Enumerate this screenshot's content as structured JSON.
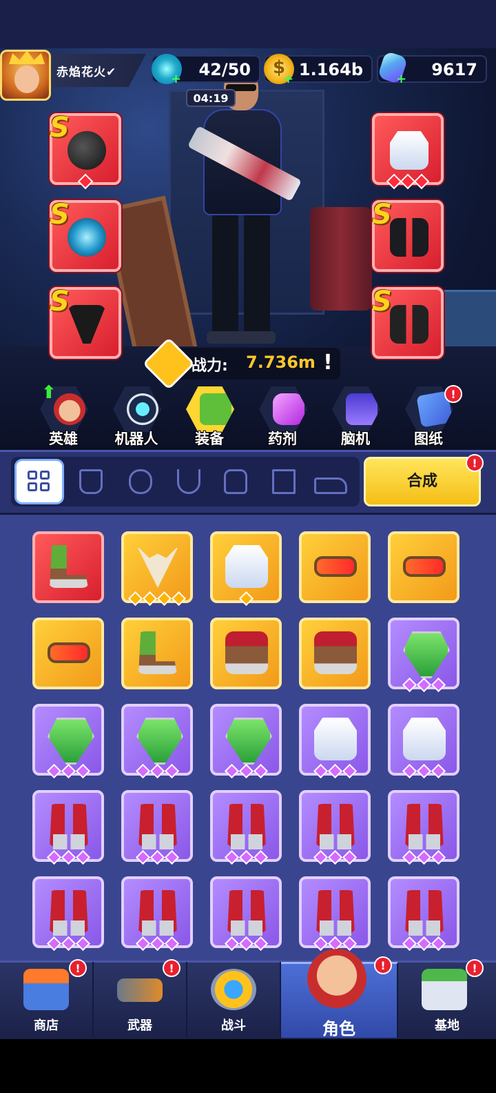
{
  "player": {
    "name": "赤焰花火✔"
  },
  "resources": {
    "energy": {
      "value": "42/50",
      "icon": "energy-icon"
    },
    "coins": {
      "value": "1.164b",
      "icon": "coin-icon"
    },
    "gems": {
      "value": "9617",
      "icon": "gem-icon"
    },
    "timer": "04:19"
  },
  "equipped": {
    "left": [
      {
        "grade": "S",
        "item": "bomb-icon",
        "stars": 1
      },
      {
        "grade": "S",
        "item": "shield-core-icon",
        "stars": 0
      },
      {
        "grade": "S",
        "item": "necklace-icon",
        "stars": 0
      }
    ],
    "right": [
      {
        "grade": "S",
        "item": "jacket-icon",
        "stars": 3
      },
      {
        "grade": "S",
        "item": "pants-icon",
        "stars": 0
      },
      {
        "grade": "S",
        "item": "boots-icon",
        "stars": 0
      }
    ]
  },
  "power": {
    "label": "战力:",
    "value": "7.736m",
    "info": "!"
  },
  "categories": [
    {
      "label": "英雄",
      "icon": "hero-icon"
    },
    {
      "label": "机器人",
      "icon": "robot-icon"
    },
    {
      "label": "装备",
      "icon": "equipment-icon"
    },
    {
      "label": "药剂",
      "icon": "potion-icon"
    },
    {
      "label": "脑机",
      "icon": "brain-machine-icon"
    },
    {
      "label": "图纸",
      "icon": "blueprint-icon"
    }
  ],
  "filters": [
    "all-icon",
    "glove-icon",
    "chest-icon",
    "necklace-icon",
    "armor-icon",
    "pants-icon",
    "boots-icon"
  ],
  "combine": {
    "label": "合成",
    "badge": "!"
  },
  "inventory": [
    {
      "rarity": "red",
      "art": "boots-green",
      "stars": 0
    },
    {
      "rarity": "gold",
      "art": "skull",
      "stars": 4
    },
    {
      "rarity": "gold",
      "art": "jacket",
      "stars": 1
    },
    {
      "rarity": "gold",
      "art": "goggles",
      "stars": 0
    },
    {
      "rarity": "gold",
      "art": "goggles",
      "stars": 0
    },
    {
      "rarity": "gold",
      "art": "goggles",
      "stars": 0
    },
    {
      "rarity": "gold",
      "art": "boots-green",
      "stars": 0
    },
    {
      "rarity": "gold",
      "art": "shoes",
      "stars": 0
    },
    {
      "rarity": "gold",
      "art": "shoes",
      "stars": 0
    },
    {
      "rarity": "purple",
      "art": "chip",
      "stars": 3
    },
    {
      "rarity": "purple",
      "art": "chip",
      "stars": 3
    },
    {
      "rarity": "purple",
      "art": "chip",
      "stars": 3
    },
    {
      "rarity": "purple",
      "art": "chip",
      "stars": 3
    },
    {
      "rarity": "purple",
      "art": "jacket",
      "stars": 3
    },
    {
      "rarity": "purple",
      "art": "jacket",
      "stars": 3
    },
    {
      "rarity": "purple",
      "art": "pants",
      "stars": 3
    },
    {
      "rarity": "purple",
      "art": "pants",
      "stars": 3
    },
    {
      "rarity": "purple",
      "art": "pants",
      "stars": 3
    },
    {
      "rarity": "purple",
      "art": "pants",
      "stars": 3
    },
    {
      "rarity": "purple",
      "art": "pants",
      "stars": 3
    },
    {
      "rarity": "purple",
      "art": "pants",
      "stars": 3
    },
    {
      "rarity": "purple",
      "art": "pants",
      "stars": 3
    },
    {
      "rarity": "purple",
      "art": "pants",
      "stars": 3
    },
    {
      "rarity": "purple",
      "art": "pants",
      "stars": 3
    },
    {
      "rarity": "purple",
      "art": "pants",
      "stars": 3
    }
  ],
  "nav": [
    {
      "label": "商店",
      "icon": "shop-icon",
      "badge": "!"
    },
    {
      "label": "武器",
      "icon": "weapon-icon",
      "badge": "!"
    },
    {
      "label": "战斗",
      "icon": "battle-icon",
      "badge": ""
    },
    {
      "label": "角色",
      "icon": "character-icon",
      "badge": "!"
    },
    {
      "label": "基地",
      "icon": "base-icon",
      "badge": "!"
    }
  ],
  "colors": {
    "accent": "#ffd632",
    "red_rarity": "#d81f2f",
    "gold_rarity": "#f29a1a",
    "purple_rarity": "#8a58e8",
    "badge": "#e8202e"
  }
}
